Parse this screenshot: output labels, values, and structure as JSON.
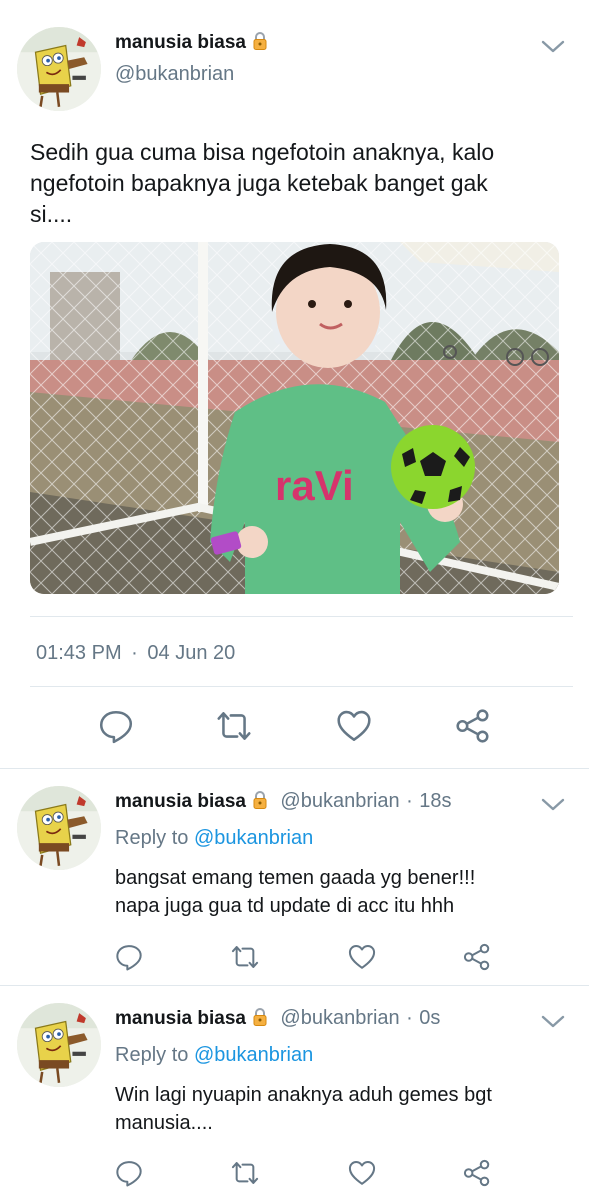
{
  "main_tweet": {
    "user_name": "manusia biasa",
    "user_handle": "@bukanbrian",
    "text_lines": [
      "Sedih gua cuma bisa ngefotoin anaknya, kalo",
      "ngefotoin bapaknya juga ketebak banget gak",
      "si...."
    ],
    "photo": {
      "shirt_text": "raVi"
    },
    "time": "01:43 PM",
    "separator": "·",
    "date": "04 Jun 20"
  },
  "replies": [
    {
      "user_name": "manusia biasa",
      "user_handle": "@bukanbrian",
      "dot": "·",
      "age": "18s",
      "reply_to_label": "Reply to",
      "reply_to_handle": "@bukanbrian",
      "text_lines": [
        "bangsat emang temen gaada yg bener!!!",
        "napa juga gua td update di acc itu hhh"
      ]
    },
    {
      "user_name": "manusia biasa",
      "user_handle": "@bukanbrian",
      "dot": "·",
      "age": "0s",
      "reply_to_label": "Reply to",
      "reply_to_handle": "@bukanbrian",
      "text_lines": [
        "Win lagi nyuapin anaknya aduh gemes bgt",
        "manusia...."
      ]
    }
  ],
  "icons": {
    "avatar": "spongebob-avatar",
    "lock": "lock-icon",
    "menu": "chevron-down-icon",
    "reply": "reply-icon",
    "retweet": "retweet-icon",
    "like": "like-icon",
    "share": "share-icon"
  },
  "colors": {
    "name": "#14171a",
    "secondary": "#657786",
    "mention": "#1b95e0",
    "divider": "#e1e8ed",
    "lock": "#f5a623"
  }
}
